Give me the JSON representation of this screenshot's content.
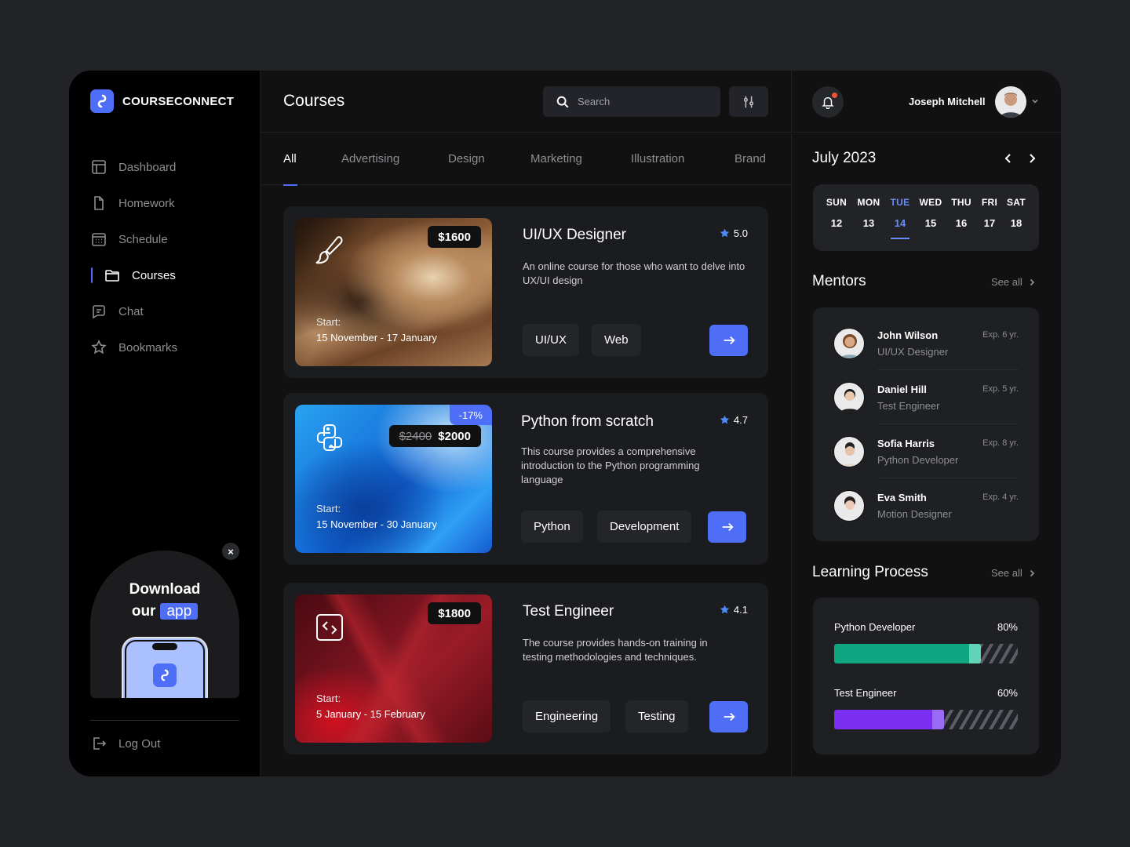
{
  "app": {
    "brand": "COURSECONNECT",
    "accent": "#4f6ef7"
  },
  "sidebar": {
    "items": [
      {
        "label": "Dashboard",
        "icon": "layout-icon",
        "active": false
      },
      {
        "label": "Homework",
        "icon": "file-icon",
        "active": false
      },
      {
        "label": "Schedule",
        "icon": "calendar-icon",
        "active": false
      },
      {
        "label": "Courses",
        "icon": "folder-icon",
        "active": true
      },
      {
        "label": "Chat",
        "icon": "chat-icon",
        "active": false
      },
      {
        "label": "Bookmarks",
        "icon": "star-icon",
        "active": false
      }
    ],
    "promo": {
      "title_line1": "Download",
      "title_our": "our",
      "title_app": "app",
      "close": "×"
    },
    "logout": "Log Out"
  },
  "header": {
    "title": "Courses",
    "search_placeholder": "Search",
    "user_name": "Joseph Mitchell",
    "has_notification": true
  },
  "tabs": [
    {
      "label": "All",
      "active": true
    },
    {
      "label": "Advertising",
      "active": false
    },
    {
      "label": "Design",
      "active": false
    },
    {
      "label": "Marketing",
      "active": false
    },
    {
      "label": "Illustration",
      "active": false
    },
    {
      "label": "Brand",
      "active": false
    }
  ],
  "courses": [
    {
      "title": "UI/UX Designer",
      "rating": "5.0",
      "price": "$1600",
      "old_price": "",
      "discount": "",
      "start_label": "Start:",
      "dates": "15 November - 17 January",
      "description": "An online course for those who want to delve into UX/UI design",
      "tags": [
        "UI/UX",
        "Web"
      ],
      "icon": "brush-icon"
    },
    {
      "title": "Python from scratch",
      "rating": "4.7",
      "price": "$2000",
      "old_price": "$2400",
      "discount": "-17%",
      "start_label": "Start:",
      "dates": "15 November - 30 January",
      "description": "This course provides a comprehensive introduction to the Python programming language",
      "tags": [
        "Python",
        "Development"
      ],
      "icon": "python-icon"
    },
    {
      "title": "Test Engineer",
      "rating": "4.1",
      "price": "$1800",
      "old_price": "",
      "discount": "",
      "start_label": "Start:",
      "dates": "5 January - 15 February",
      "description": "The course provides hands-on training in testing methodologies and techniques.",
      "tags": [
        "Engineering",
        "Testing"
      ],
      "icon": "code-icon"
    }
  ],
  "calendar": {
    "month": "July 2023",
    "days": [
      {
        "name": "SUN",
        "num": "12"
      },
      {
        "name": "MON",
        "num": "13"
      },
      {
        "name": "TUE",
        "num": "14",
        "today": true
      },
      {
        "name": "WED",
        "num": "15"
      },
      {
        "name": "THU",
        "num": "16"
      },
      {
        "name": "FRI",
        "num": "17"
      },
      {
        "name": "SAT",
        "num": "18"
      }
    ]
  },
  "mentors": {
    "title": "Mentors",
    "see_all": "See all",
    "items": [
      {
        "name": "John Wilson",
        "role": "UI/UX Designer",
        "exp": "Exp. 6 yr."
      },
      {
        "name": "Daniel Hill",
        "role": "Test Engineer",
        "exp": "Exp. 5 yr."
      },
      {
        "name": "Sofia Harris",
        "role": "Python Developer",
        "exp": "Exp. 8 yr."
      },
      {
        "name": "Eva Smith",
        "role": "Motion Designer",
        "exp": "Exp. 4 yr."
      }
    ]
  },
  "learning": {
    "title": "Learning Process",
    "see_all": "See all",
    "items": [
      {
        "label": "Python Developer",
        "percent_text": "80%",
        "progress": 0.8,
        "color": "#0ea581",
        "tip_color": "#5fd4b6"
      },
      {
        "label": "Test Engineer",
        "percent_text": "60%",
        "progress": 0.6,
        "color": "#7a2ff2",
        "tip_color": "#9a6bf6"
      }
    ]
  }
}
